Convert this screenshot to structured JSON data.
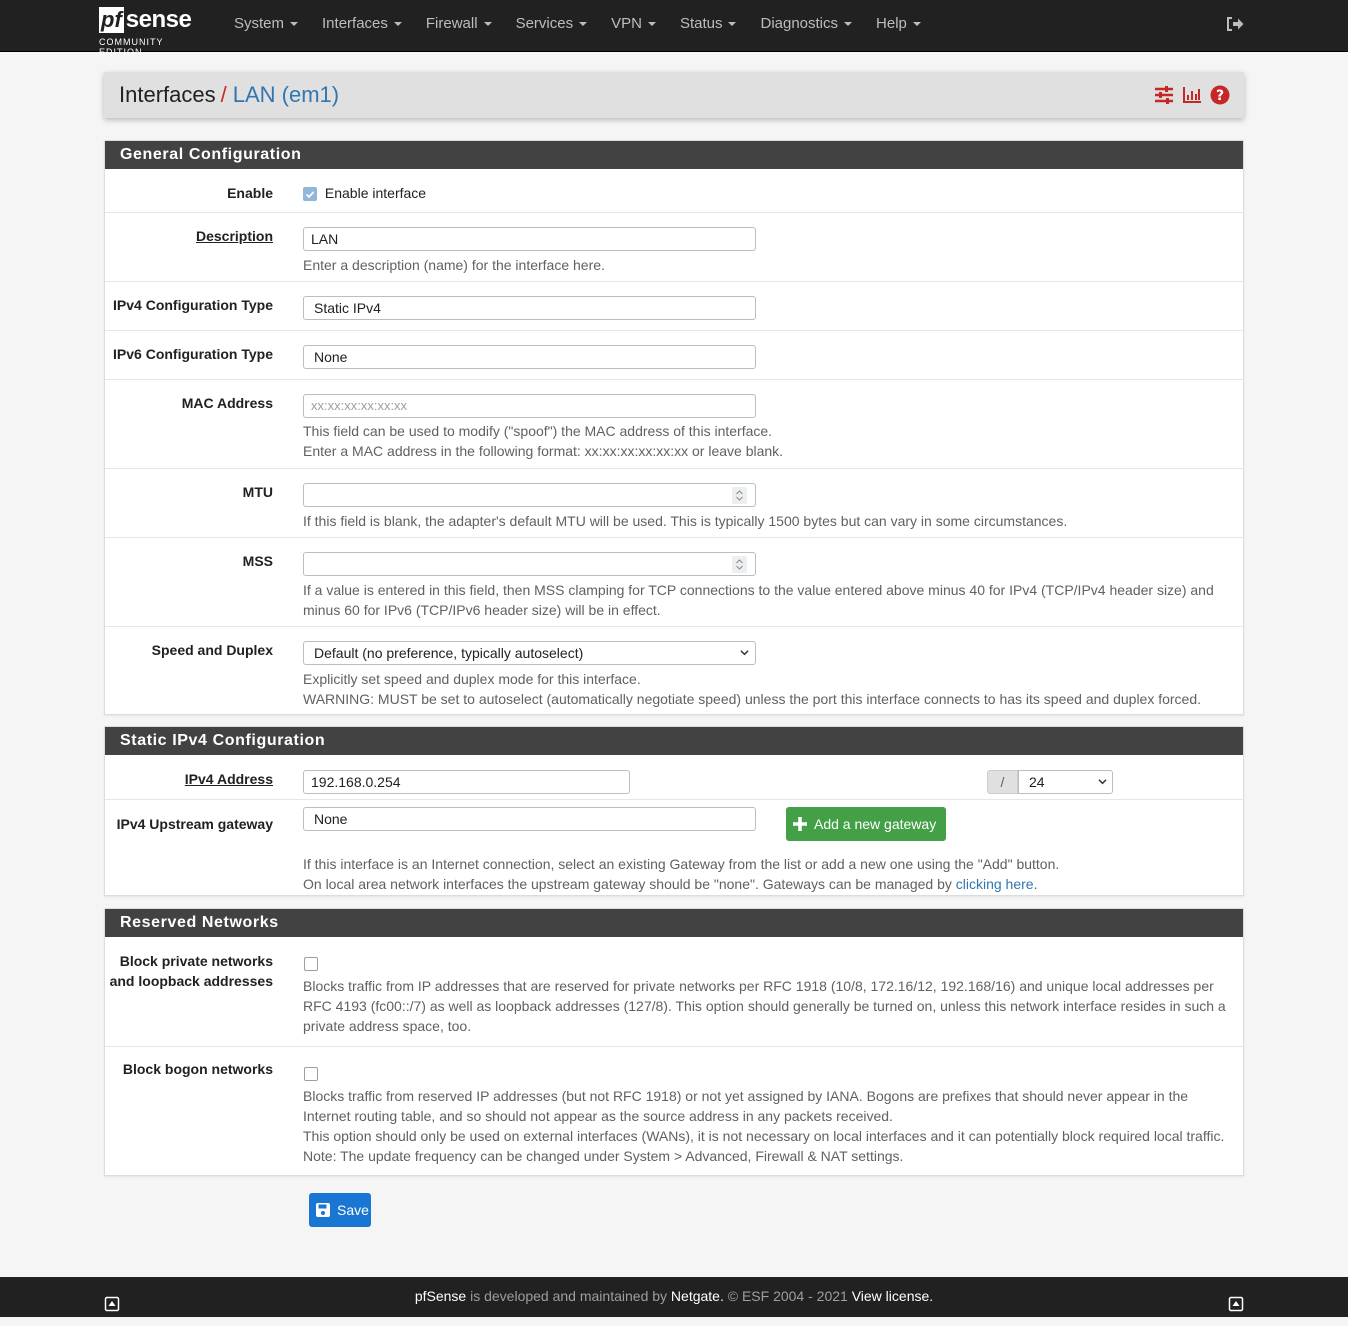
{
  "navbar": {
    "brand_pf": "pf",
    "brand_sense": "sense",
    "brand_edition": "COMMUNITY EDITION",
    "menu": [
      "System",
      "Interfaces",
      "Firewall",
      "Services",
      "VPN",
      "Status",
      "Diagnostics",
      "Help"
    ],
    "logout_icon": "sign-out-icon"
  },
  "header": {
    "crumb_root": "Interfaces",
    "crumb_sep": "/",
    "crumb_current": "LAN (em1)",
    "icons": [
      "sliders-icon",
      "bar-chart-icon",
      "question-circle-icon"
    ],
    "accent_color": "#c62828"
  },
  "general": {
    "title": "General Configuration",
    "enable": {
      "label": "Enable",
      "checkbox_label": "Enable interface",
      "checked": true
    },
    "description": {
      "label": "Description",
      "value": "LAN",
      "help": "Enter a description (name) for the interface here."
    },
    "ipv4_type": {
      "label": "IPv4 Configuration Type",
      "value": "Static IPv4"
    },
    "ipv6_type": {
      "label": "IPv6 Configuration Type",
      "value": "None"
    },
    "mac": {
      "label": "MAC Address",
      "placeholder": "xx:xx:xx:xx:xx:xx",
      "help1": "This field can be used to modify (\"spoof\") the MAC address of this interface.",
      "help2": "Enter a MAC address in the following format: xx:xx:xx:xx:xx:xx or leave blank."
    },
    "mtu": {
      "label": "MTU",
      "value": "",
      "help": "If this field is blank, the adapter's default MTU will be used. This is typically 1500 bytes but can vary in some circumstances."
    },
    "mss": {
      "label": "MSS",
      "value": "",
      "help": "If a value is entered in this field, then MSS clamping for TCP connections to the value entered above minus 40 for IPv4 (TCP/IPv4 header size) and minus 60 for IPv6 (TCP/IPv6 header size) will be in effect."
    },
    "speed": {
      "label": "Speed and Duplex",
      "value": "Default (no preference, typically autoselect)",
      "help1": "Explicitly set speed and duplex mode for this interface.",
      "help2": "WARNING: MUST be set to autoselect (automatically negotiate speed) unless the port this interface connects to has its speed and duplex forced."
    }
  },
  "static_ipv4": {
    "title": "Static IPv4 Configuration",
    "address": {
      "label": "IPv4 Address",
      "value": "192.168.0.254",
      "slash": "/",
      "cidr": "24"
    },
    "gateway": {
      "label": "IPv4 Upstream gateway",
      "value": "None",
      "add_button": "Add a new gateway",
      "help1": "If this interface is an Internet connection, select an existing Gateway from the list or add a new one using the \"Add\" button.",
      "help2": "On local area network interfaces the upstream gateway should be \"none\". Gateways can be managed by ",
      "help_link": "clicking here",
      "help_end": "."
    }
  },
  "reserved": {
    "title": "Reserved Networks",
    "private": {
      "label1": "Block private networks",
      "label2": "and loopback addresses",
      "checked": false,
      "help": "Blocks traffic from IP addresses that are reserved for private networks per RFC 1918 (10/8, 172.16/12, 192.168/16) and unique local addresses per RFC 4193 (fc00::/7) as well as loopback addresses (127/8). This option should generally be turned on, unless this network interface resides in such a private address space, too."
    },
    "bogon": {
      "label": "Block bogon networks",
      "checked": false,
      "help1": "Blocks traffic from reserved IP addresses (but not RFC 1918) or not yet assigned by IANA. Bogons are prefixes that should never appear in the Internet routing table, and so should not appear as the source address in any packets received.",
      "help2": "This option should only be used on external interfaces (WANs), it is not necessary on local interfaces and it can potentially block required local traffic.",
      "help3": "Note: The update frequency can be changed under System > Advanced, Firewall & NAT settings."
    }
  },
  "save_label": "Save",
  "footer": {
    "product": "pfSense",
    "middle": " is developed and maintained by ",
    "company": "Netgate.",
    "copyright": " © ESF 2004 - 2021 ",
    "license": "View license."
  }
}
